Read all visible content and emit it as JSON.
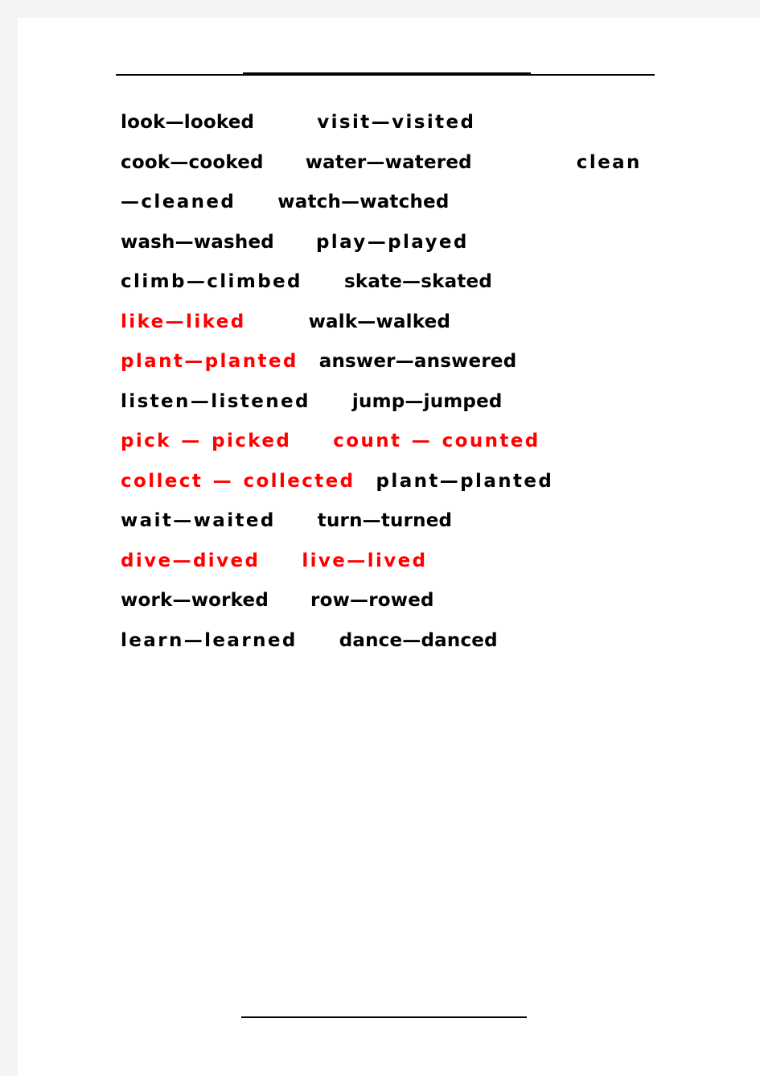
{
  "document": {
    "page_background": "#ffffff",
    "canvas_background": "#f3f4f4",
    "text_color": "#000000",
    "highlight_color": "#ff0000",
    "header_rule_present": true,
    "footer_rule_present": true
  },
  "verb_lines": [
    {
      "line_number": 1,
      "entries": [
        {
          "verb": "look",
          "past": "looked",
          "text": "look—looked",
          "color": "#000000"
        },
        {
          "verb": "visit",
          "past": "visited",
          "text": "visit—visited",
          "color": "#000000"
        }
      ]
    },
    {
      "line_number": 2,
      "entries": [
        {
          "verb": "cook",
          "past": "cooked",
          "text": "cook—cooked",
          "color": "#000000"
        },
        {
          "verb": "water",
          "past": "watered",
          "text": "water—watered",
          "color": "#000000"
        },
        {
          "verb": "clean",
          "past": "cleaned",
          "text": "clean—cleaned",
          "color": "#000000"
        }
      ]
    },
    {
      "line_number": 3,
      "entries": [
        {
          "verb": "watch",
          "past": "watched",
          "text": "watch—watched",
          "color": "#000000"
        }
      ]
    },
    {
      "line_number": 4,
      "entries": [
        {
          "verb": "wash",
          "past": "washed",
          "text": "wash—washed",
          "color": "#000000"
        },
        {
          "verb": "play",
          "past": "played",
          "text": "play—played",
          "color": "#000000"
        }
      ]
    },
    {
      "line_number": 5,
      "entries": [
        {
          "verb": "climb",
          "past": "climbed",
          "text": "climb—climbed",
          "color": "#000000"
        },
        {
          "verb": "skate",
          "past": "skated",
          "text": "skate—skated",
          "color": "#000000"
        }
      ]
    },
    {
      "line_number": 6,
      "entries": [
        {
          "verb": "like",
          "past": "liked",
          "text": "like—liked",
          "color": "#ff0000"
        },
        {
          "verb": "walk",
          "past": "walked",
          "text": "walk—walked",
          "color": "#000000"
        }
      ]
    },
    {
      "line_number": 7,
      "entries": [
        {
          "verb": "plant",
          "past": "planted",
          "text": "plant—planted",
          "color": "#ff0000"
        },
        {
          "verb": "answer",
          "past": "answered",
          "text": "answer—answered",
          "color": "#000000"
        }
      ]
    },
    {
      "line_number": 8,
      "entries": [
        {
          "verb": "listen",
          "past": "listened",
          "text": "listen—listened",
          "color": "#000000"
        },
        {
          "verb": "jump",
          "past": "jumped",
          "text": "jump—jumped",
          "color": "#000000"
        }
      ]
    },
    {
      "line_number": 9,
      "entries": [
        {
          "verb": "pick",
          "past": "picked",
          "text": "pick — picked",
          "color": "#ff0000"
        },
        {
          "verb": "count",
          "past": "counted",
          "text": "count — counted",
          "color": "#ff0000"
        },
        {
          "verb": "collect",
          "past": "collected",
          "text": "collect — collected",
          "color": "#ff0000"
        }
      ]
    },
    {
      "line_number": 10,
      "entries": [
        {
          "verb": "plant",
          "past": "planted",
          "text": "plant—planted",
          "color": "#000000"
        }
      ]
    },
    {
      "line_number": 11,
      "entries": [
        {
          "verb": "wait",
          "past": "waited",
          "text": "wait—waited",
          "color": "#000000"
        },
        {
          "verb": "turn",
          "past": "turned",
          "text": "turn—turned",
          "color": "#000000"
        }
      ]
    },
    {
      "line_number": 12,
      "entries": [
        {
          "verb": "dive",
          "past": "dived",
          "text": "dive—dived",
          "color": "#ff0000"
        },
        {
          "verb": "live",
          "past": "lived",
          "text": "live—lived",
          "color": "#ff0000"
        }
      ]
    },
    {
      "line_number": 13,
      "entries": [
        {
          "verb": "work",
          "past": "worked",
          "text": "work—worked",
          "color": "#000000"
        },
        {
          "verb": "row",
          "past": "rowed",
          "text": "row—rowed",
          "color": "#000000"
        }
      ]
    },
    {
      "line_number": 14,
      "entries": [
        {
          "verb": "learn",
          "past": "learned",
          "text": "learn—learned",
          "color": "#000000"
        },
        {
          "verb": "dance",
          "past": "danced",
          "text": "dance—danced",
          "color": "#000000"
        }
      ]
    }
  ],
  "flow": {
    "p1_look": "look—looked",
    "p2_visit": "visit—visited",
    "p3_cook": "cook—cooked",
    "p4_water": "water—watered",
    "p5_clean": "clean—cleaned",
    "p6_watch": "watch—watched",
    "p7_wash": "wash—washed",
    "p8_play": "play—played",
    "p9_climb": "climb—climbed",
    "p10_skate": "skate—skated",
    "p11_like": "like—liked",
    "p12_walk": "walk—walked",
    "p13_plant": "plant—planted",
    "p14_answer": "answer—answered",
    "p15_listen": "listen—listened",
    "p16_jump": "jump—jumped",
    "p17_pick": "pick — picked",
    "p18_count": "count — counted",
    "p19_collect": "collect — collected",
    "p20_plant": "plant—planted",
    "p21_wait": "wait—waited",
    "p22_turn": "turn—turned",
    "p23_dive": "dive—dived",
    "p24_live": "live—lived",
    "p25_work": "work—worked",
    "p26_row": "row—rowed",
    "p27_learn": "learn—learned",
    "p28_dance": "dance—danced"
  }
}
